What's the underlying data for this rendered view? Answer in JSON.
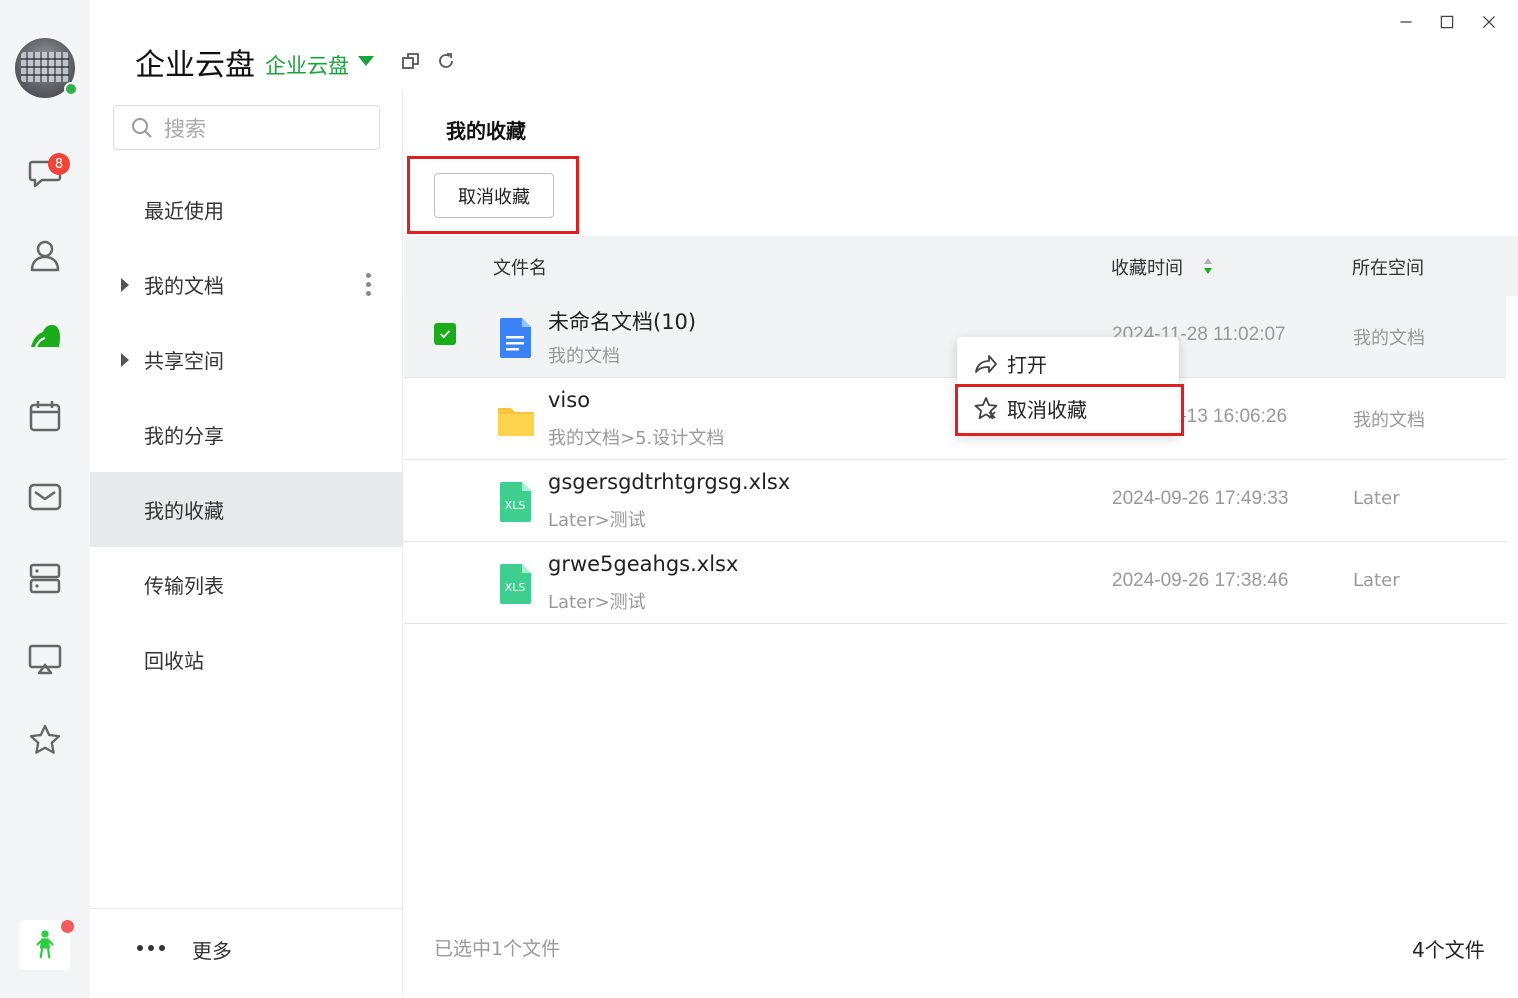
{
  "header": {
    "title": "企业云盘",
    "workspace": "企业云盘"
  },
  "rail": {
    "chat_badge": "8"
  },
  "search": {
    "placeholder": "搜索"
  },
  "nav": {
    "items": [
      {
        "label": "最近使用"
      },
      {
        "label": "我的文档"
      },
      {
        "label": "共享空间"
      },
      {
        "label": "我的分享"
      },
      {
        "label": "我的收藏"
      },
      {
        "label": "传输列表"
      },
      {
        "label": "回收站"
      }
    ],
    "more": "更多"
  },
  "main": {
    "title": "我的收藏",
    "unfav_button": "取消收藏",
    "columns": {
      "name": "文件名",
      "time": "收藏时间",
      "space": "所在空间"
    },
    "rows": [
      {
        "name": "未命名文档(10)",
        "path": "我的文档",
        "time": "2024-11-28 11:02:07",
        "space": "我的文档",
        "type": "doc",
        "selected": true
      },
      {
        "name": "viso",
        "path": "我的文档>5.设计文档",
        "time": "2024-11-13 16:06:26",
        "space": "我的文档",
        "type": "folder",
        "selected": false
      },
      {
        "name": "gsgersgdtrhtgrgsg.xlsx",
        "path": "Later>测试",
        "time": "2024-09-26 17:49:33",
        "space": "Later",
        "type": "xls",
        "selected": false
      },
      {
        "name": "grwe5geahgs.xlsx",
        "path": "Later>测试",
        "time": "2024-09-26 17:38:46",
        "space": "Later",
        "type": "xls",
        "selected": false
      }
    ]
  },
  "context_menu": {
    "open": "打开",
    "unfav": "取消收藏"
  },
  "footer": {
    "selected": "已选中1个文件",
    "count": "4个文件"
  },
  "icons": {
    "xls_label": "XLS"
  },
  "colors": {
    "accent": "#1aa33a",
    "highlight": "#e02020",
    "badge": "#f04438"
  }
}
